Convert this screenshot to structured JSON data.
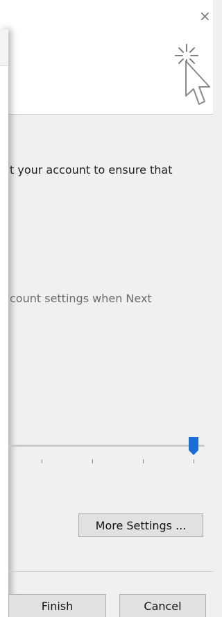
{
  "window": {
    "close_glyph": "×",
    "wizard_icon": "cursor-sparkle-icon"
  },
  "content": {
    "description": "t your account to ensure that",
    "next_hint": "count settings when Next"
  },
  "slider": {
    "level_percent": 100,
    "tick_count": 4
  },
  "buttons": {
    "more_settings": "More Settings ...",
    "finish": "Finish",
    "cancel": "Cancel"
  },
  "colors": {
    "accent": "#1a6fd6",
    "background": "#f0f0f0",
    "header": "#ffffff"
  }
}
